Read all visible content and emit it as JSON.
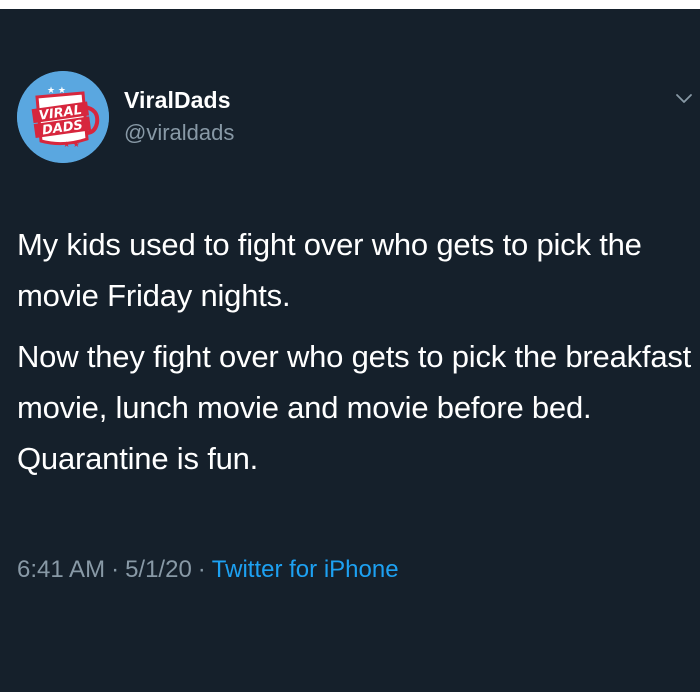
{
  "tweet": {
    "author": {
      "display_name": "ViralDads",
      "handle": "@viraldads",
      "avatar": {
        "logo_line1": "VIRAL",
        "logo_line2": "DADS",
        "background_color": "#5aa7e0",
        "logo_color": "#d7263d"
      }
    },
    "paragraphs": [
      "My kids used to fight over who gets to pick the movie Friday nights.",
      "Now they fight over who gets to pick the breakfast movie, lunch movie and movie before bed. Quarantine is fun."
    ],
    "time": "6:41 AM",
    "separator": "·",
    "date": "5/1/20",
    "source": "Twitter for iPhone",
    "menu_icon": "chevron-down-icon"
  },
  "colors": {
    "background": "#15202b",
    "text": "#ffffff",
    "secondary_text": "#8899a6",
    "accent": "#1da1f2"
  }
}
